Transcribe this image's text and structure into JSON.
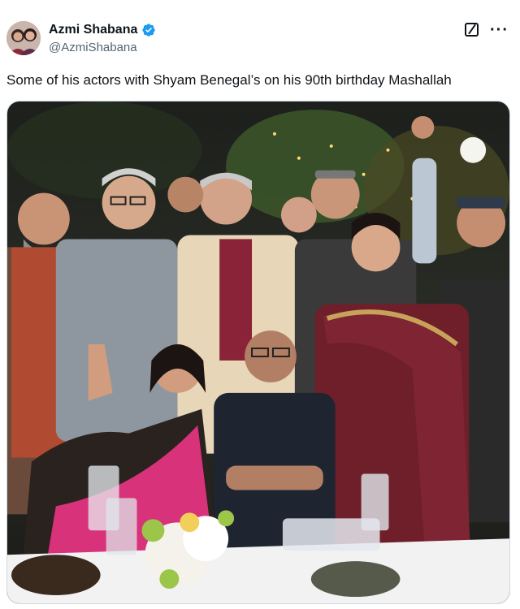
{
  "author": {
    "display_name": "Azmi Shabana",
    "handle": "@AzmiShabana",
    "verified": true
  },
  "tweet": {
    "text": "Some of his actors with Shyam Benegal’s on his 90th birthday Mashallah"
  },
  "icons": {
    "verified": "verified-badge-icon",
    "grok": "grok-icon",
    "more": "more-options-icon"
  },
  "colors": {
    "verified": "#1d9bf0",
    "text_primary": "#0f1419",
    "text_secondary": "#536471"
  }
}
